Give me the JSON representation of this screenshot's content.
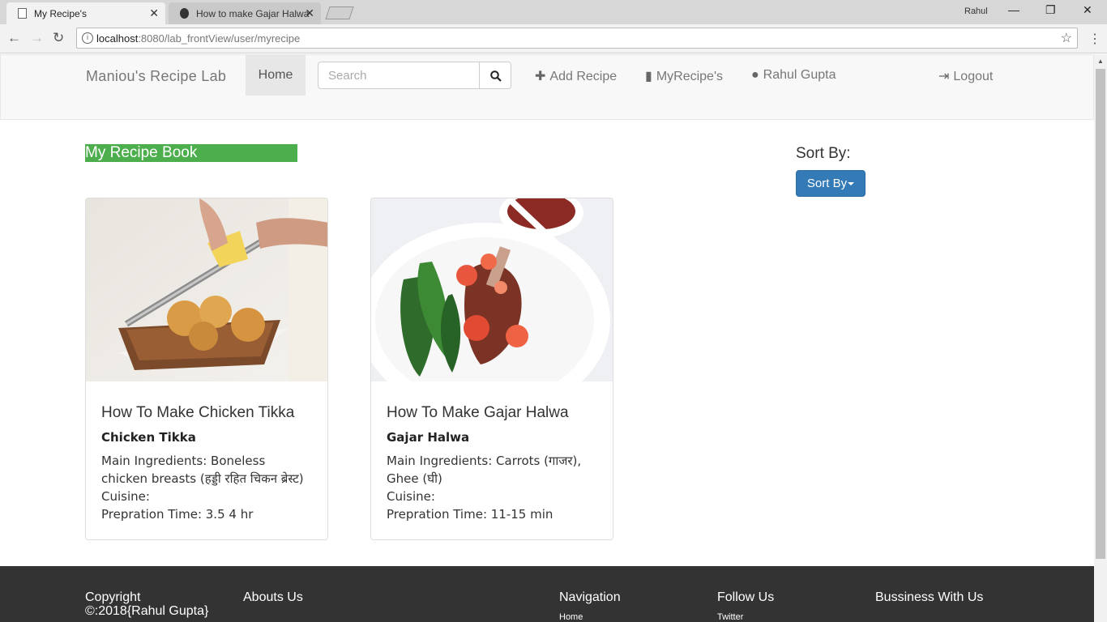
{
  "browser": {
    "tabs": [
      {
        "title": "My Recipe's",
        "active": true
      },
      {
        "title": "How to make Gajar Halwa",
        "active": false
      }
    ],
    "profile": "Rahul",
    "url_host": "localhost",
    "url_path": ":8080/lab_frontView/user/myrecipe"
  },
  "navbar": {
    "brand": "Maniou's Recipe Lab",
    "home": "Home",
    "search_placeholder": "Search",
    "add_recipe": "Add Recipe",
    "my_recipes": "MyRecipe's",
    "user": "Rahul Gupta",
    "logout": "Logout"
  },
  "main": {
    "heading": "My Recipe Book",
    "sort_label": "Sort By:",
    "sort_button": "Sort By"
  },
  "recipes": [
    {
      "title": "How To Make Chicken Tikka",
      "name": "Chicken Tikka",
      "ingredients": "Main Ingredients: Boneless chicken breasts (हड्डी रहित चिकन ब्रेस्ट)",
      "cuisine": "Cuisine:",
      "prep_time": "Prepration Time: 3.5 4 hr"
    },
    {
      "title": "How To Make Gajar Halwa",
      "name": "Gajar Halwa",
      "ingredients": "Main Ingredients: Carrots (गाजर), Ghee (घी)",
      "cuisine": "Cuisine:",
      "prep_time": "Prepration Time: 11-15 min"
    }
  ],
  "footer": {
    "copyright_line1": "Copyright",
    "copyright_line2": "©:2018{Rahul Gupta}",
    "abouts_us": "Abouts Us",
    "navigation": "Navigation",
    "navigation_first": "Home",
    "follow_us": "Follow Us",
    "follow_first": "Twitter",
    "business": "Bussiness With Us"
  },
  "colors": {
    "heading_bg": "#4cae4c",
    "sort_button": "#337ab7",
    "footer_bg": "#333333"
  }
}
